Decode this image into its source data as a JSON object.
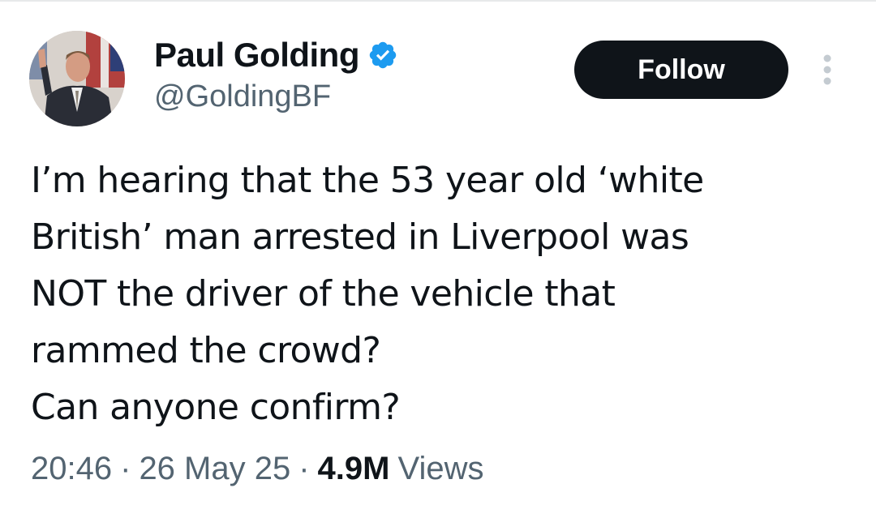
{
  "author": {
    "display_name": "Paul Golding",
    "handle": "@GoldingBF",
    "verified": true,
    "verified_color": "#1d9bf0"
  },
  "actions": {
    "follow_label": "Follow",
    "more_icon": "more-vertical-icon"
  },
  "tweet": {
    "lines": [
      "I’m hearing that the 53 year old ‘white",
      "British’ man arrested in Liverpool was",
      "NOT the driver of the vehicle that",
      "rammed the crowd?",
      "Can anyone confirm?"
    ]
  },
  "meta": {
    "time": "20:46",
    "date": "26 May 25",
    "separator": "·",
    "views_count": "4.9M",
    "views_label": "Views"
  },
  "colors": {
    "text": "#0f1419",
    "secondary": "#536471",
    "button_bg": "#0f1419"
  }
}
